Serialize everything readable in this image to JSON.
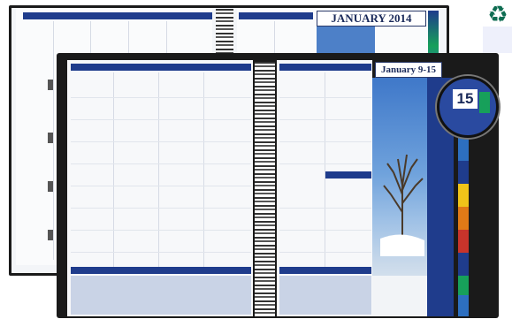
{
  "image": {
    "description_kind": "product photo of a weekly-monthly planner",
    "back_planner": {
      "month_title": "JANUARY 2014"
    },
    "front_planner": {
      "week_title": "January 9-15",
      "magnified_date": "15"
    },
    "colors": {
      "header_blue": "#1f3c8c",
      "tab_colors": [
        "#1f3c8c",
        "#17a05a",
        "#2d6fc0",
        "#f0c419",
        "#e07a17",
        "#c8342b",
        "#1f3c8c",
        "#17a05a",
        "#2d6fc0",
        "#4a4a8c"
      ],
      "logo_green": "#0f6d52"
    },
    "icons": {
      "corner_logo": "recycle-icon"
    }
  }
}
